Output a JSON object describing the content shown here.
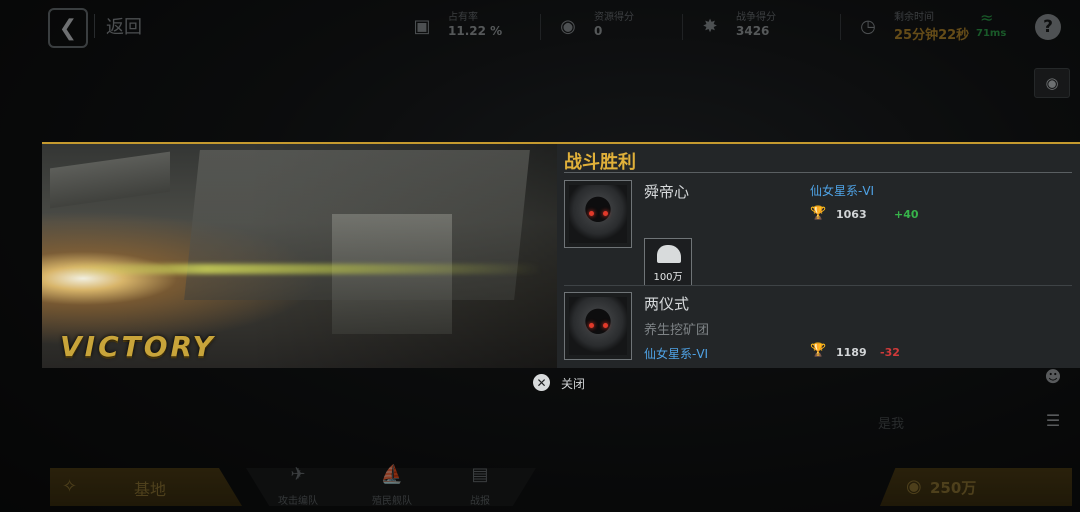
{
  "header": {
    "back_label": "返回",
    "stats": [
      {
        "label": "占有率",
        "value": "11.22 %"
      },
      {
        "label": "资源得分",
        "value": "0"
      },
      {
        "label": "战争得分",
        "value": "3426"
      },
      {
        "label": "剩余时间",
        "value": "25分钟22秒"
      }
    ],
    "ping": "71ms"
  },
  "modal": {
    "banner_text": "VICTORY",
    "title": "战斗胜利",
    "players": [
      {
        "name": "舜帝心",
        "guild": "",
        "galaxy": "仙女星系-VI",
        "trophies": "1063",
        "delta": "+40",
        "reward": "100万"
      },
      {
        "name": "两仪式",
        "guild": "养生挖矿团",
        "galaxy": "仙女星系-VI",
        "trophies": "1189",
        "delta": "-32"
      }
    ],
    "close_label": "关闭"
  },
  "side": {
    "me_label": "是我"
  },
  "bottom": {
    "base_label": "基地",
    "tabs": [
      {
        "label": "攻击编队"
      },
      {
        "label": "殖民舰队"
      },
      {
        "label": "战报"
      }
    ],
    "money_label": "250万"
  },
  "colors": {
    "accent_gold": "#c59a2f",
    "galaxy_blue": "#4fa3e6",
    "gain_green": "#37b34a",
    "loss_red": "#d03a3a",
    "ping_green": "#2ea34b"
  }
}
